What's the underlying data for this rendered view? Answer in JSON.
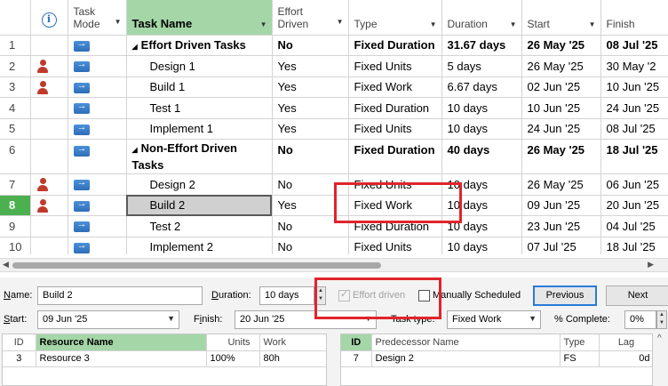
{
  "columns": {
    "info": "ⓘ",
    "task_mode": "Task Mode",
    "task_name": "Task Name",
    "effort_driven": "Effort Driven",
    "type": "Type",
    "duration": "Duration",
    "start": "Start",
    "finish": "Finish"
  },
  "rows": [
    {
      "id": "1",
      "name": "Effort Driven Tasks",
      "effort": "No",
      "type": "Fixed Duration",
      "duration": "31.67 days",
      "start": "26 May '25",
      "finish": "08 Jul '25"
    },
    {
      "id": "2",
      "name": "Design 1",
      "effort": "Yes",
      "type": "Fixed Units",
      "duration": "5 days",
      "start": "26 May '25",
      "finish": "30 May '2"
    },
    {
      "id": "3",
      "name": "Build 1",
      "effort": "Yes",
      "type": "Fixed Work",
      "duration": "6.67 days",
      "start": "02 Jun '25",
      "finish": "10 Jun '25"
    },
    {
      "id": "4",
      "name": "Test 1",
      "effort": "Yes",
      "type": "Fixed Duration",
      "duration": "10 days",
      "start": "10 Jun '25",
      "finish": "24 Jun '25"
    },
    {
      "id": "5",
      "name": "Implement 1",
      "effort": "Yes",
      "type": "Fixed Units",
      "duration": "10 days",
      "start": "24 Jun '25",
      "finish": "08 Jul '25"
    },
    {
      "id": "6",
      "name": "Non-Effort Driven Tasks",
      "effort": "No",
      "type": "Fixed Duration",
      "duration": "40 days",
      "start": "26 May '25",
      "finish": "18 Jul '25"
    },
    {
      "id": "7",
      "name": "Design 2",
      "effort": "No",
      "type": "Fixed Units",
      "duration": "10 days",
      "start": "26 May '25",
      "finish": "06 Jun '25"
    },
    {
      "id": "8",
      "name": "Build 2",
      "effort": "Yes",
      "type": "Fixed Work",
      "duration": "10 days",
      "start": "09 Jun '25",
      "finish": "20 Jun '25"
    },
    {
      "id": "9",
      "name": "Test 2",
      "effort": "No",
      "type": "Fixed Duration",
      "duration": "10 days",
      "start": "23 Jun '25",
      "finish": "04 Jul '25"
    },
    {
      "id": "10",
      "name": "Implement 2",
      "effort": "No",
      "type": "Fixed Units",
      "duration": "10 days",
      "start": "07 Jul '25",
      "finish": "18 Jul '25"
    }
  ],
  "form": {
    "name_label": "Name:",
    "name_value": "Build 2",
    "duration_label": "Duration:",
    "duration_value": "10 days",
    "effort_driven_label": "Effort driven",
    "manually_scheduled_label": "Manually Scheduled",
    "previous_label": "Previous",
    "next_label": "Next",
    "start_label": "Start:",
    "start_value": "09 Jun '25",
    "finish_label": "Finish:",
    "finish_value": "20 Jun '25",
    "task_type_label": "Task type:",
    "task_type_value": "Fixed Work",
    "complete_label": "% Complete:",
    "complete_value": "0%"
  },
  "resources": {
    "headers": {
      "id": "ID",
      "name": "Resource Name",
      "units": "Units",
      "work": "Work"
    },
    "rows": [
      {
        "id": "3",
        "name": "Resource 3",
        "units": "100%",
        "work": "80h"
      }
    ]
  },
  "predecessors": {
    "headers": {
      "id": "ID",
      "name": "Predecessor Name",
      "type": "Type",
      "lag": "Lag"
    },
    "rows": [
      {
        "id": "7",
        "name": "Design 2",
        "type": "FS",
        "lag": "0d"
      }
    ]
  },
  "colors": {
    "header_sorted": "#a5d6a7",
    "selected_row_id": "#4caf50",
    "highlight_box": "#e0242b",
    "resource_icon": "#c0392b"
  }
}
